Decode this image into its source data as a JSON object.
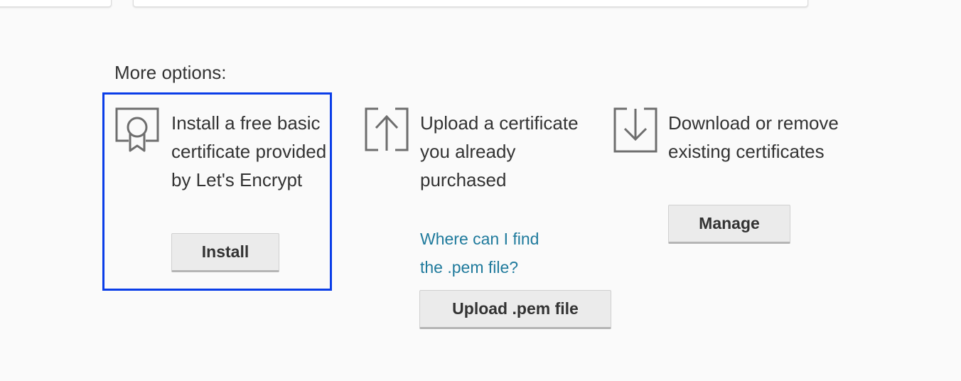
{
  "section": {
    "title": "More options:"
  },
  "options": {
    "install": {
      "icon": "certificate-ribbon-icon",
      "description": "Install a free basic certificate provided by Let's Encrypt",
      "button_label": "Install"
    },
    "upload": {
      "icon": "upload-arrow-icon",
      "description": "Upload a certificate you already purchased",
      "help_link": "Where can I find the .pem file?",
      "button_label": "Upload .pem file"
    },
    "manage": {
      "icon": "download-arrow-icon",
      "description": "Download or remove existing certificates",
      "button_label": "Manage"
    }
  },
  "colors": {
    "focus_outline": "#0a3de8",
    "link": "#1f7a9c",
    "text": "#333333",
    "icon": "#6e6e6e",
    "button_bg": "#ebebeb"
  }
}
